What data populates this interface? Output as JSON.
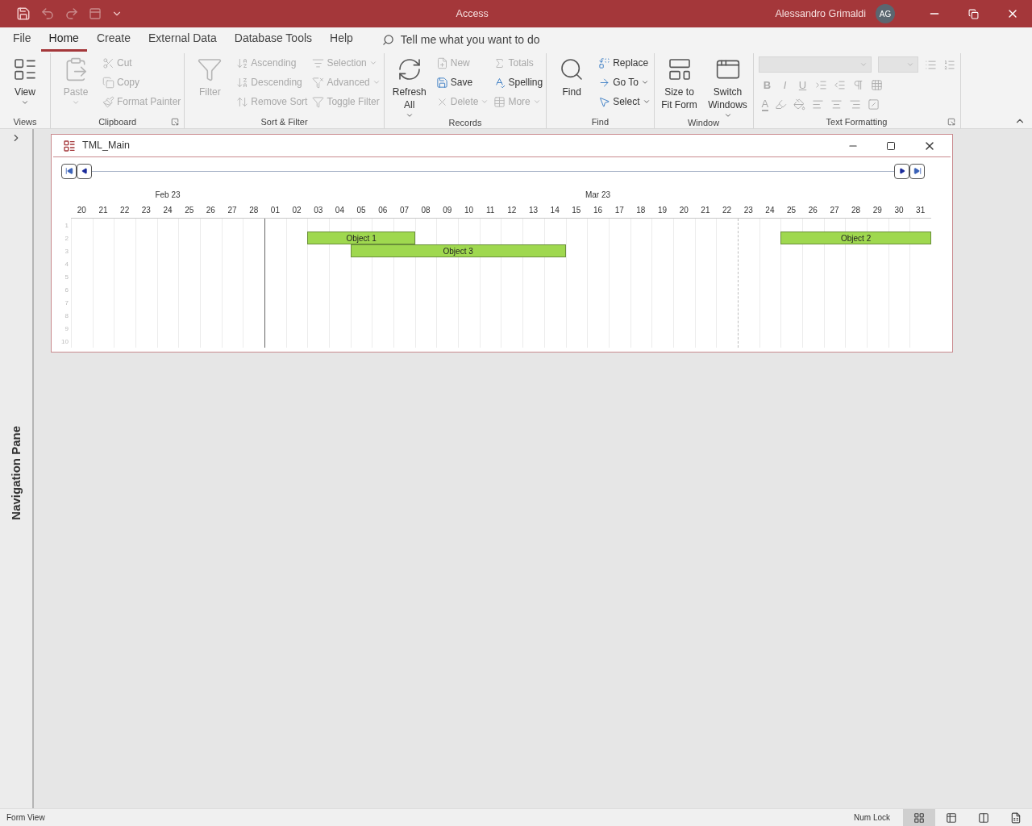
{
  "app": {
    "title": "Access",
    "user": "Alessandro Grimaldi",
    "initials": "AG"
  },
  "tabs": [
    {
      "label": "File",
      "selected": false
    },
    {
      "label": "Home",
      "selected": true
    },
    {
      "label": "Create",
      "selected": false
    },
    {
      "label": "External Data",
      "selected": false
    },
    {
      "label": "Database Tools",
      "selected": false
    },
    {
      "label": "Help",
      "selected": false
    }
  ],
  "tell_me": {
    "placeholder": "Tell me what you want to do"
  },
  "ribbon_groups": [
    {
      "label": "Views",
      "launcher": false,
      "items": [
        {
          "kind": "large",
          "label": "View",
          "disabled": false,
          "dropdown": true
        }
      ]
    },
    {
      "label": "Clipboard",
      "launcher": true,
      "items": [
        {
          "kind": "large",
          "label": "Paste",
          "disabled": true,
          "dropdown": true
        },
        {
          "kind": "small",
          "label": "Cut",
          "disabled": true,
          "dropdown": false
        },
        {
          "kind": "small",
          "label": "Copy",
          "disabled": true,
          "dropdown": false
        },
        {
          "kind": "small",
          "label": "Format Painter",
          "disabled": true,
          "dropdown": false
        }
      ]
    },
    {
      "label": "Sort & Filter",
      "launcher": false,
      "items": [
        {
          "kind": "large",
          "label": "Filter",
          "disabled": true,
          "dropdown": false
        },
        {
          "kind": "small",
          "label": "Ascending",
          "disabled": true,
          "dropdown": false
        },
        {
          "kind": "small",
          "label": "Descending",
          "disabled": true,
          "dropdown": false
        },
        {
          "kind": "small",
          "label": "Remove Sort",
          "disabled": true,
          "dropdown": false
        },
        {
          "kind": "small",
          "label": "Selection",
          "disabled": true,
          "dropdown": true
        },
        {
          "kind": "small",
          "label": "Advanced",
          "disabled": true,
          "dropdown": true
        },
        {
          "kind": "small",
          "label": "Toggle Filter",
          "disabled": true,
          "dropdown": false
        }
      ]
    },
    {
      "label": "Records",
      "launcher": false,
      "items": [
        {
          "kind": "large",
          "label": "Refresh All",
          "disabled": false,
          "dropdown": true
        },
        {
          "kind": "small",
          "label": "New",
          "disabled": true,
          "dropdown": false
        },
        {
          "kind": "small",
          "label": "Save",
          "disabled": false,
          "dropdown": false
        },
        {
          "kind": "small",
          "label": "Delete",
          "disabled": true,
          "dropdown": true
        },
        {
          "kind": "small",
          "label": "Totals",
          "disabled": true,
          "dropdown": false
        },
        {
          "kind": "small",
          "label": "Spelling",
          "disabled": false,
          "dropdown": false
        },
        {
          "kind": "small",
          "label": "More",
          "disabled": true,
          "dropdown": true
        }
      ]
    },
    {
      "label": "Find",
      "launcher": false,
      "items": [
        {
          "kind": "large",
          "label": "Find",
          "disabled": false,
          "dropdown": false
        },
        {
          "kind": "small",
          "label": "Replace",
          "disabled": false,
          "dropdown": false
        },
        {
          "kind": "small",
          "label": "Go To",
          "disabled": false,
          "dropdown": true
        },
        {
          "kind": "small",
          "label": "Select",
          "disabled": false,
          "dropdown": true
        }
      ]
    },
    {
      "label": "Window",
      "launcher": false,
      "items": [
        {
          "kind": "large",
          "label": "Size to Fit Form",
          "disabled": false,
          "dropdown": false
        },
        {
          "kind": "large",
          "label": "Switch Windows",
          "disabled": false,
          "dropdown": true
        }
      ]
    },
    {
      "label": "Text Formatting",
      "launcher": true,
      "items": [
        {
          "kind": "formatting",
          "disabled": true,
          "letters": [
            "B",
            "I",
            "U"
          ],
          "font_color": "A"
        }
      ]
    }
  ],
  "navigation_pane": {
    "label": "Navigation Pane",
    "expanded": false
  },
  "form": {
    "title": "TML_Main",
    "months": [
      {
        "label": "Feb 23",
        "days": [
          {
            "label": "20",
            "today": false
          },
          {
            "label": "21",
            "today": false
          },
          {
            "label": "22",
            "today": false
          },
          {
            "label": "23",
            "today": false
          },
          {
            "label": "24",
            "today": false
          },
          {
            "label": "25",
            "today": false
          },
          {
            "label": "26",
            "today": false
          },
          {
            "label": "27",
            "today": false
          },
          {
            "label": "28",
            "today": false
          }
        ]
      },
      {
        "label": "Mar 23",
        "days": [
          {
            "label": "01",
            "today": false
          },
          {
            "label": "02",
            "today": false
          },
          {
            "label": "03",
            "today": false
          },
          {
            "label": "04",
            "today": false
          },
          {
            "label": "05",
            "today": false
          },
          {
            "label": "06",
            "today": false
          },
          {
            "label": "07",
            "today": false
          },
          {
            "label": "08",
            "today": false
          },
          {
            "label": "09",
            "today": false
          },
          {
            "label": "10",
            "today": false
          },
          {
            "label": "11",
            "today": false
          },
          {
            "label": "12",
            "today": false
          },
          {
            "label": "13",
            "today": false
          },
          {
            "label": "14",
            "today": false
          },
          {
            "label": "15",
            "today": false
          },
          {
            "label": "16",
            "today": false
          },
          {
            "label": "17",
            "today": false
          },
          {
            "label": "18",
            "today": false
          },
          {
            "label": "19",
            "today": false
          },
          {
            "label": "20",
            "today": false
          },
          {
            "label": "21",
            "today": false
          },
          {
            "label": "22",
            "today": false
          },
          {
            "label": "23",
            "today": true
          },
          {
            "label": "24",
            "today": false
          },
          {
            "label": "25",
            "today": false
          },
          {
            "label": "26",
            "today": false
          },
          {
            "label": "27",
            "today": false
          },
          {
            "label": "28",
            "today": false
          },
          {
            "label": "29",
            "today": false
          },
          {
            "label": "30",
            "today": false
          },
          {
            "label": "31",
            "today": false
          }
        ]
      }
    ],
    "rows": [
      {
        "label": "1",
        "bars": []
      },
      {
        "label": "2",
        "bars": [
          {
            "label": "Object 1"
          },
          {
            "label": "Object 2"
          }
        ]
      },
      {
        "label": "3",
        "bars": [
          {
            "label": "Object 3"
          }
        ]
      },
      {
        "label": "4",
        "bars": []
      },
      {
        "label": "5",
        "bars": []
      },
      {
        "label": "6",
        "bars": []
      },
      {
        "label": "7",
        "bars": []
      },
      {
        "label": "8",
        "bars": []
      },
      {
        "label": "9",
        "bars": []
      },
      {
        "label": "10",
        "bars": []
      }
    ]
  },
  "status_bar": {
    "left": "Form View",
    "right": "Num Lock",
    "views": [
      {
        "selected": true
      },
      {
        "selected": false
      },
      {
        "selected": false
      },
      {
        "selected": false
      }
    ]
  }
}
